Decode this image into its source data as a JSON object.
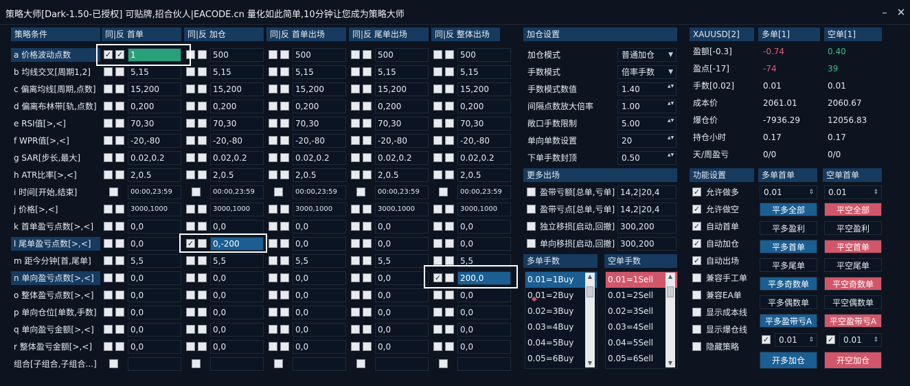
{
  "title": "策略大师[Dark-1.50-已授权]  可贴牌,招合伙人|EACODE.cn  量化如此简单,10分钟让您成为策略大师",
  "headers": {
    "cond": "策略条件",
    "col0": "同|反 首单",
    "col1": "同|反 加仓",
    "col2": "同|反 首单出场",
    "col3": "同|反 尾单出场",
    "col4": "同|反 整体出场",
    "add": "加仓设置",
    "more": "更多出场",
    "multi_lots": "多单手数",
    "short_lots": "空单手数",
    "func": "功能设置",
    "multi_first": "多单首单",
    "short_first": "空单首单"
  },
  "rows": [
    {
      "label": "a 价格波动点数",
      "v": [
        "1",
        "500",
        "500",
        "500",
        "500"
      ]
    },
    {
      "label": "b 均线交叉[周期1,2]",
      "v": [
        "5,15",
        "5,15",
        "5,15",
        "5,15",
        "5,15"
      ]
    },
    {
      "label": "c 偏离均线[周期,点数]",
      "v": [
        "15,200",
        "15,200",
        "15,200",
        "15,200",
        "15,200"
      ]
    },
    {
      "label": "d 偏离布林带[轨,点数]",
      "v": [
        "0,200",
        "0,200",
        "0,200",
        "0,200",
        "0,200"
      ]
    },
    {
      "label": "e RSI值[>,<]",
      "v": [
        "70,30",
        "70,30",
        "70,30",
        "70,30",
        "70,30"
      ]
    },
    {
      "label": "f WPR值[>,<]",
      "v": [
        "-20,-80",
        "-20,-80",
        "-20,-80",
        "-20,-80",
        "-20,-80"
      ]
    },
    {
      "label": "g SAR[步长,最大]",
      "v": [
        "0.02,0.2",
        "0.02,0.2",
        "0.02,0.2",
        "0.02,0.2",
        "0.02,0.2"
      ]
    },
    {
      "label": "h ATR比率[>,<]",
      "v": [
        "2,0.5",
        "2,0.5",
        "2,0.5",
        "2,0.5",
        "2,0.5"
      ]
    },
    {
      "label": "i 时间[开始,结束]",
      "v": [
        "00:00,23:59",
        "00:00,23:59",
        "00:00,23:59",
        "00:00,23:59",
        "00:00,23:59"
      ]
    },
    {
      "label": "j 价格[>,<]",
      "v": [
        "3000,1000",
        "3000,1000",
        "3000,1000",
        "3000,1000",
        "3000,1000"
      ]
    },
    {
      "label": "k 首单盈亏点数[>,<]",
      "v": [
        "0,0",
        "0,0",
        "0,0",
        "0,0",
        "0,0"
      ]
    },
    {
      "label": "l 尾单盈亏点数[>,<]",
      "v": [
        "0,0",
        "0,-200",
        "0,0",
        "0,0",
        "0,0"
      ]
    },
    {
      "label": "m 距今分钟[首,尾单]",
      "v": [
        "5,5",
        "5,5",
        "5,5",
        "5,5",
        "5,5"
      ]
    },
    {
      "label": "n 单向盈亏点数[>,<]",
      "v": [
        "0,0",
        "0,0",
        "0,0",
        "0,0",
        "200,0"
      ]
    },
    {
      "label": "o 整体盈亏点数[>,<]",
      "v": [
        "0,0",
        "0,0",
        "0,0",
        "0,0",
        "0,0"
      ]
    },
    {
      "label": "p 单向仓位[单数,手数]",
      "v": [
        "0,0",
        "0,0",
        "0,0",
        "0,0",
        "0,0"
      ]
    },
    {
      "label": "q 单向盈亏金额[>,<]",
      "v": [
        "0,0",
        "0,0",
        "0,0",
        "0,0",
        "0,0"
      ]
    },
    {
      "label": "r 整体盈亏金额[>,<]",
      "v": [
        "0,0",
        "0,0",
        "0,0",
        "0,0",
        "0,0"
      ]
    },
    {
      "label": "组合[子组合,子组合...]",
      "v": [
        "",
        "",
        "",
        "",
        ""
      ]
    }
  ],
  "add_settings": [
    {
      "label": "加仓模式",
      "value": "普通加仓"
    },
    {
      "label": "手数模式",
      "value": "倍率手数"
    },
    {
      "label": "手数模式数值",
      "value": "1.40"
    },
    {
      "label": "间隔点数放大倍率",
      "value": "1.00"
    },
    {
      "label": "敞口手数限制",
      "value": "5.00"
    },
    {
      "label": "单向单数设置",
      "value": "20"
    },
    {
      "label": "下单手数封顶",
      "value": "0.50"
    }
  ],
  "more_exit": [
    {
      "label": "盈带亏额[总单,亏单]",
      "value": "14,2|20,4"
    },
    {
      "label": "盈带亏点[总单,亏单]",
      "value": "14,2|20,4"
    },
    {
      "label": "独立移损[启动,回撤]",
      "value": "300,200"
    },
    {
      "label": "单向移损[启动,回撤]",
      "value": "300,200"
    }
  ],
  "buy_lots": [
    "0.01=1Buy",
    "0.01=2Buy",
    "0.02=3Buy",
    "0.03=4Buy",
    "0.04=5Buy",
    "0.05=6Buy"
  ],
  "sell_lots": [
    "0.01=1Sell",
    "0.01=2Sell",
    "0.02=3Sell",
    "0.03=4Sell",
    "0.04=5Sell",
    "0.05=6Sell"
  ],
  "stats": {
    "symbol": "XAUUSD[2]",
    "buy_col": "多单[1]",
    "sell_col": "空单[1]",
    "rows": [
      {
        "label": "盈额[-0.3]",
        "buy": "-0.74",
        "sell": "0.40"
      },
      {
        "label": "盈点[-17]",
        "buy": "-74",
        "sell": "39"
      },
      {
        "label": "手数[0.02]",
        "buy": "0.01",
        "sell": "0.01"
      },
      {
        "label": "成本价",
        "buy": "2061.01",
        "sell": "2060.67"
      },
      {
        "label": "爆仓价",
        "buy": "-7936.29",
        "sell": "12056.83"
      },
      {
        "label": "持仓小时",
        "buy": "0.17",
        "sell": "0.17"
      },
      {
        "label": "天/周盈亏",
        "buy": "0/0",
        "sell": "0/0"
      }
    ]
  },
  "func_settings": [
    "允许做多",
    "允许做空",
    "自动首单",
    "自动加仓",
    "自动出场",
    "兼容手工单",
    "兼容EA单",
    "显示成本线",
    "显示爆仓线",
    "隐藏策略"
  ],
  "first_buy_value": "0.01",
  "first_sell_value": "0.01",
  "buy_buttons": [
    "平多全部",
    "平多盈利",
    "平多首单",
    "平多尾单",
    "平多奇数单",
    "平多偶数单",
    "平多盈带亏A"
  ],
  "sell_buttons": [
    "平空全部",
    "平空盈利",
    "平空首单",
    "平空尾单",
    "平空奇数单",
    "平空偶数单",
    "平空盈带亏A"
  ],
  "buy_add_value": "0.01",
  "sell_add_value": "0.01",
  "open_buy": "开多加仓",
  "open_sell": "开空加仓",
  "colors": {
    "accent": "#173a5f",
    "buy_blue": "#1a5e92",
    "sell_red": "#d2566a",
    "green": "#2aa07a",
    "neg": "#e06073",
    "pos": "#3fb98a"
  }
}
